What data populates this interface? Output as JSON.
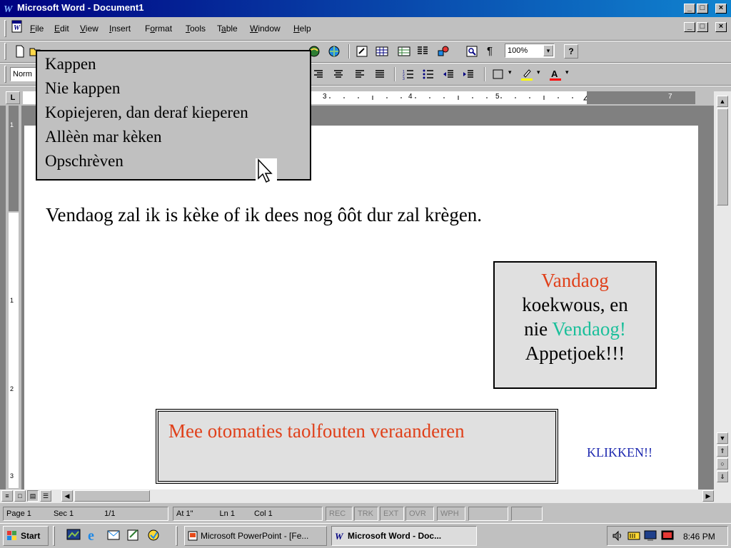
{
  "window": {
    "title": "Microsoft Word - Document1",
    "minimize_glyph": "_",
    "restore_glyph": "□",
    "close_glyph": "×"
  },
  "menubar": {
    "items": [
      {
        "label": "File",
        "accel": "F",
        "rest": "ile"
      },
      {
        "label": "Edit",
        "accel": "E",
        "rest": "dit"
      },
      {
        "label": "View",
        "accel": "V",
        "rest": "iew"
      },
      {
        "label": "Insert",
        "accel": "I",
        "rest": "nsert"
      },
      {
        "label": "Format",
        "pre": "F",
        "accel": "o",
        "rest": "rmat"
      },
      {
        "label": "Tools",
        "accel": "T",
        "rest": "ools"
      },
      {
        "label": "Table",
        "pre": "T",
        "accel": "a",
        "rest": "ble"
      },
      {
        "label": "Window",
        "accel": "W",
        "rest": "indow"
      },
      {
        "label": "Help",
        "accel": "H",
        "rest": "elp"
      }
    ]
  },
  "toolbar": {
    "zoom": "100%",
    "paragraph_mark": "¶",
    "help_glyph": "?",
    "style_value": "Norm",
    "dropdown_glyph": "▾"
  },
  "ruler": {
    "numbers": [
      "3",
      "4",
      "5",
      "7"
    ]
  },
  "vertical_ruler": {
    "numbers": [
      "1",
      "1",
      "2",
      "3"
    ]
  },
  "popup_menu": {
    "items": [
      "Kappen",
      "Nie kappen",
      "Kopiejeren, dan deraf kieperen",
      "Allèèn mar kèken",
      "Opschrèven"
    ]
  },
  "document": {
    "main_text": "Vendaog zal ik is kèke of ik dees nog ôôt dur zal krègen.",
    "textbox": {
      "line1": "Vandaog",
      "line2": "koekwous, en",
      "line3_prefix": "nie ",
      "line3_colored": "Vendaog!",
      "line4": "Appetjoek!!!"
    },
    "autocorrect_button": "Mee otomaties taolfouten veraanderen",
    "klikken": "KLIKKEN!!"
  },
  "statusbar": {
    "page": "Page 1",
    "sec": "Sec 1",
    "pages": "1/1",
    "at": "At 1\"",
    "ln": "Ln 1",
    "col": "Col 1",
    "rec": "REC",
    "trk": "TRK",
    "ext": "EXT",
    "ovr": "OVR",
    "wph": "WPH"
  },
  "taskbar": {
    "start": "Start",
    "task1": "Microsoft PowerPoint - [Fe...",
    "task2": "Microsoft Word - Doc...",
    "clock": "8:46 PM"
  },
  "colors": {
    "title_start": "#000080",
    "title_end": "#1084d0",
    "orange_red": "#e0401a",
    "teal": "#1abf9a",
    "link_blue": "#1f2ab0"
  }
}
